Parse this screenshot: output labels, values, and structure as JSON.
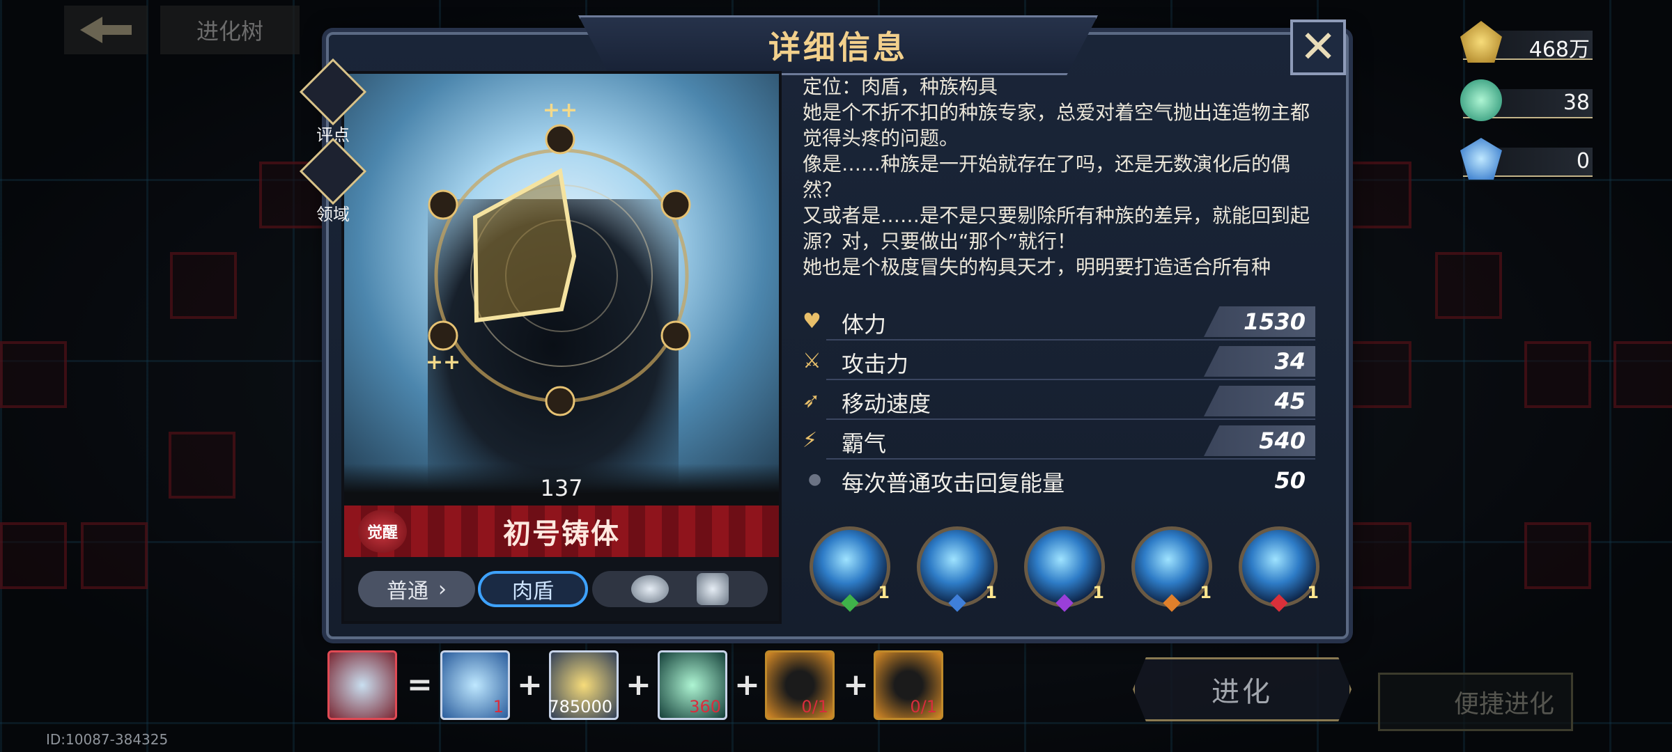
{
  "top_nav": {
    "back_label": "",
    "tree_label": "进化树"
  },
  "dialog": {
    "title": "详细信息",
    "side_buttons": [
      {
        "label": "评点",
        "icon": "rating-icon"
      },
      {
        "label": "领域",
        "icon": "domain-icon"
      }
    ],
    "portrait": {
      "level": "137",
      "awaken_label": "觉醒",
      "name": "初号铸体"
    },
    "tags": {
      "normal": "普通",
      "role": "肉盾",
      "race_icons": [
        "golem-icon",
        "robot-head-icon"
      ]
    },
    "description": [
      "定位：肉盾，种族构具",
      "她是个不折不扣的种族专家，总爱对着空气抛出连造物主都觉得头疼的问题。",
      "像是……种族是一开始就存在了吗，还是无数演化后的偶然？",
      "又或者是……是不是只要剔除所有种族的差异，就能回到起源？对，只要做出“那个”就行！",
      "她也是个极度冒失的构具天才，明明要打造适合所有种"
    ],
    "stats": [
      {
        "icon": "heart-icon",
        "label": "体力",
        "value": "1530"
      },
      {
        "icon": "sword-icon",
        "label": "攻击力",
        "value": "34"
      },
      {
        "icon": "boot-icon",
        "label": "移动速度",
        "value": "45"
      },
      {
        "icon": "claw-icon",
        "label": "霸气",
        "value": "540"
      },
      {
        "icon": "dot-icon",
        "label": "每次普通攻击回复能量",
        "value": "50"
      }
    ],
    "skills": [
      {
        "level": "1",
        "gem_color": "#3fb24a"
      },
      {
        "level": "1",
        "gem_color": "#3f7fd9"
      },
      {
        "level": "1",
        "gem_color": "#9a3fd9"
      },
      {
        "level": "1",
        "gem_color": "#e0802b"
      },
      {
        "level": "1",
        "gem_color": "#d9303a"
      }
    ]
  },
  "resources": [
    {
      "icon": "gold-pentagon-icon",
      "value": "468万"
    },
    {
      "icon": "green-orb-icon",
      "value": "38"
    },
    {
      "icon": "blue-crystal-icon",
      "value": "0"
    }
  ],
  "evolution": {
    "items": [
      {
        "icon": "blue-crystal-icon",
        "count": "1",
        "color": "#d92d3d"
      },
      {
        "icon": "gold-pentagon-icon",
        "count": "785000",
        "color": "#ffffff"
      },
      {
        "icon": "green-orb-icon",
        "count": "360",
        "color": "#d92d3d"
      },
      {
        "icon": "silhouette-unit-icon",
        "count": "0/1",
        "color": "#d92d3d"
      },
      {
        "icon": "silhouette-unit-icon",
        "count": "0/1",
        "color": "#d92d3d"
      }
    ],
    "evolve_label": "进化",
    "quick_evolve_label": "便捷进化"
  },
  "footer": {
    "uid": "ID:10087-384325"
  },
  "colors": {
    "accent_gold": "#f2d08c",
    "panel": "#1a2538",
    "red_banner": "#8f141c",
    "tag_blue": "#3ea2ff"
  }
}
